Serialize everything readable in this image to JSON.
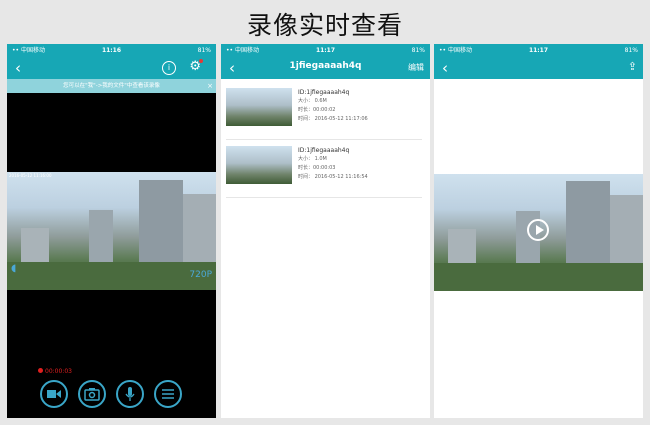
{
  "page_title": "录像实时查看",
  "status": {
    "carrier": "•• 中国移动",
    "battery": "81%"
  },
  "screen1": {
    "time": "11:16",
    "banner": "您可以在\"我\"->我的文件\"中查看该录像",
    "banner_close": "×",
    "timestamp": "2016-05-12 11:16:00",
    "resolution": "720P",
    "rec_time": "00:00:03",
    "controls": [
      "video-camera",
      "camera",
      "microphone",
      "menu"
    ]
  },
  "screen2": {
    "time": "11:17",
    "title": "1jfiegaaaah4q",
    "edit": "编辑",
    "items": [
      {
        "id": "ID:1jfiegaaaah4q",
        "size": "大小： 0.6M",
        "duration": "时长：00:00:02",
        "time": "时间： 2016-05-12 11:17:06"
      },
      {
        "id": "ID:1jfiegaaaah4q",
        "size": "大小： 1.0M",
        "duration": "时长：00:00:03",
        "time": "时间： 2016-05-12 11:16:54"
      }
    ]
  },
  "screen3": {
    "time": "11:17"
  }
}
